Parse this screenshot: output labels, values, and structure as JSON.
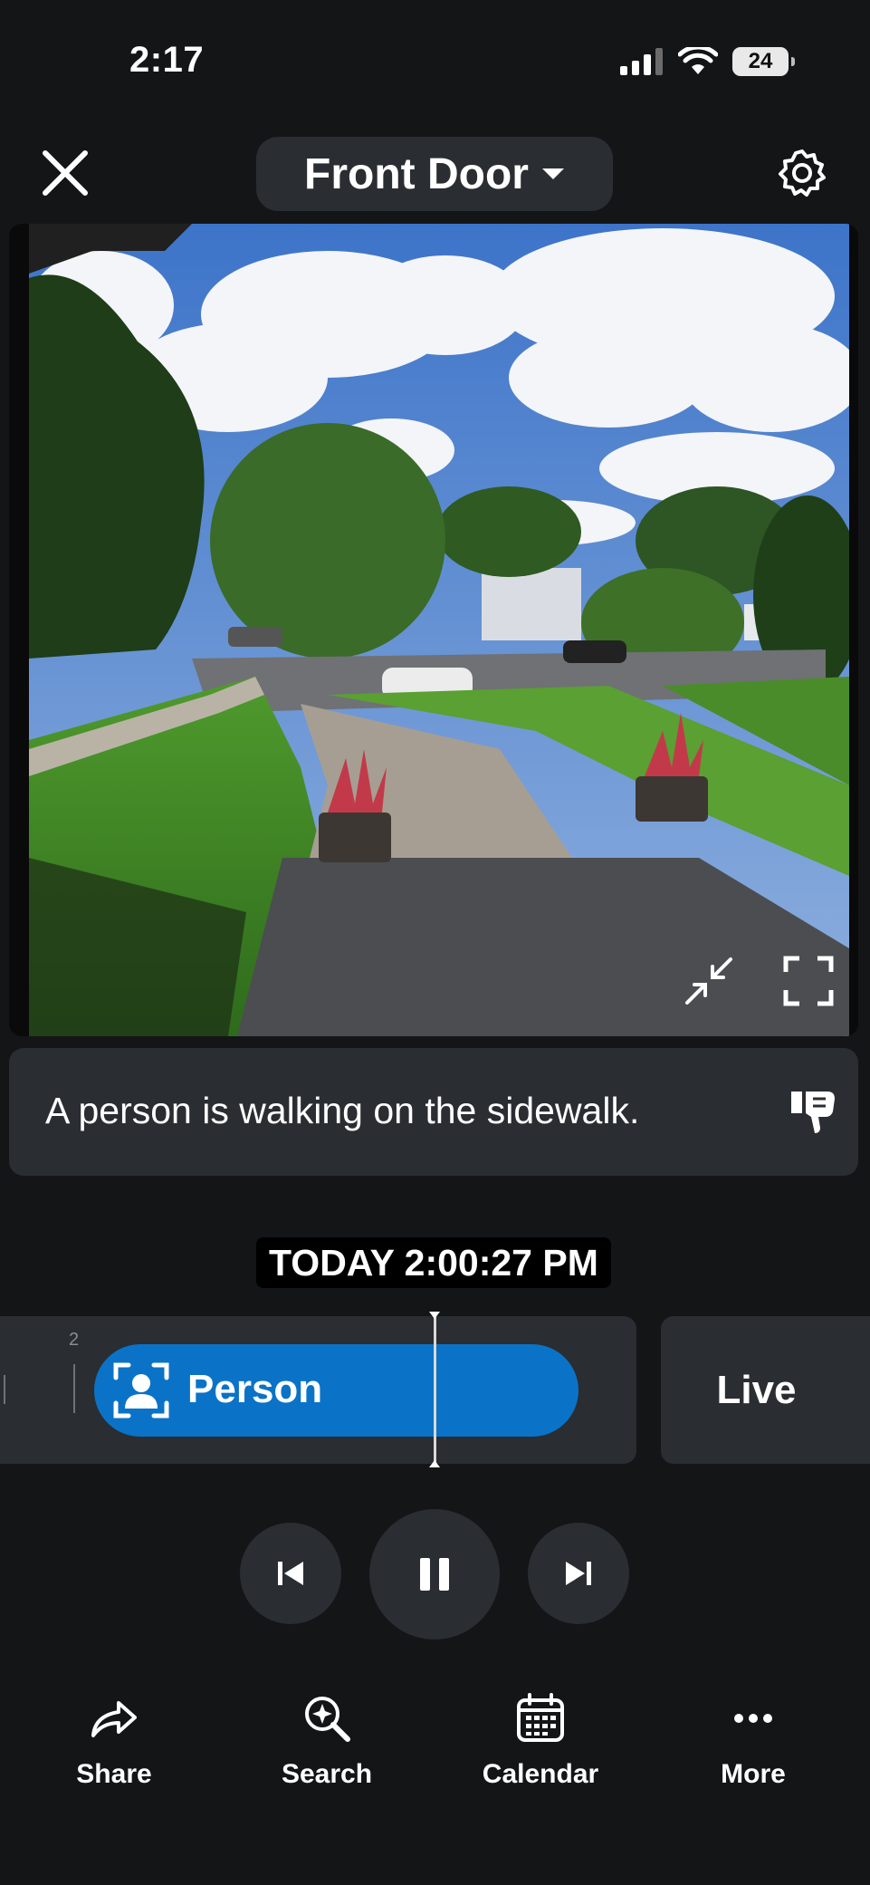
{
  "status_bar": {
    "time": "2:17",
    "battery": "24"
  },
  "header": {
    "title": "Front Door"
  },
  "caption": {
    "text": "A person is walking on the sidewalk."
  },
  "timestamp": "TODAY 2:00:27 PM",
  "timeline": {
    "tick_label": "2",
    "event_label": "Person",
    "live_label": "Live"
  },
  "toolbar": {
    "share": "Share",
    "search": "Search",
    "calendar": "Calendar",
    "more": "More"
  },
  "colors": {
    "background": "#141517",
    "surface": "#2a2d31",
    "accent": "#0a73c7"
  },
  "icons": [
    "close-icon",
    "chevron-down-icon",
    "gear-icon",
    "collapse-icon",
    "fullscreen-icon",
    "thumbs-down-icon",
    "person-icon",
    "skip-previous-icon",
    "pause-icon",
    "skip-next-icon",
    "share-icon",
    "search-sparkle-icon",
    "calendar-icon",
    "more-icon"
  ]
}
